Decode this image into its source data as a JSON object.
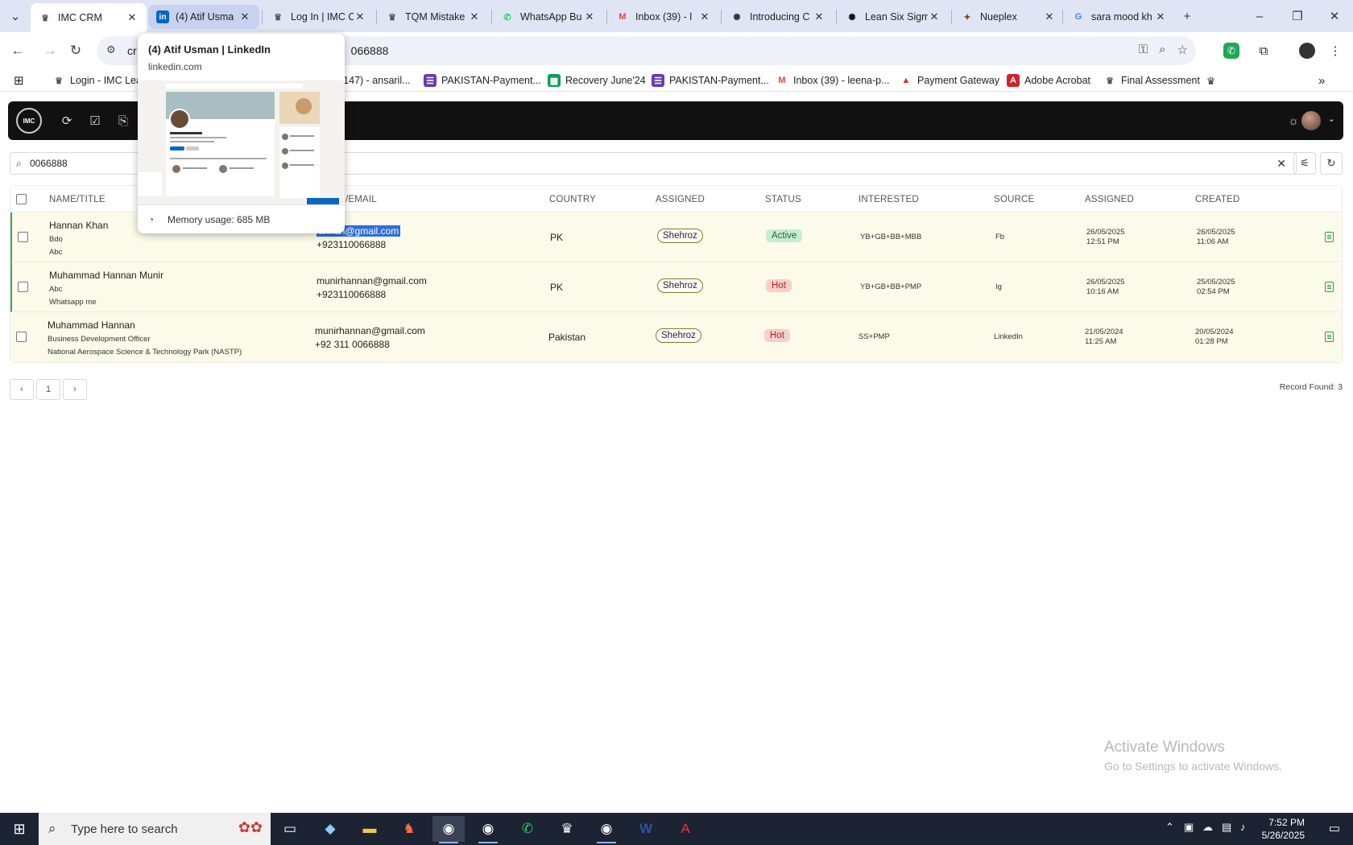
{
  "browser": {
    "tabs": [
      {
        "title": "IMC CRM",
        "icon": "imc-crm-icon",
        "icon_glyph": "♛",
        "icon_color": "#555555",
        "active": true
      },
      {
        "title": "(4) Atif Usma",
        "icon": "linkedin-icon",
        "icon_glyph": "in",
        "icon_color": "#0a66c2",
        "hovered": true
      },
      {
        "title": "Log In | IMC C",
        "icon": "imc-icon",
        "icon_glyph": "♛",
        "icon_color": "#555555"
      },
      {
        "title": "TQM Mistake",
        "icon": "imc-icon",
        "icon_glyph": "♛",
        "icon_color": "#555555"
      },
      {
        "title": "WhatsApp Bu",
        "icon": "whatsapp-icon",
        "icon_glyph": "✆",
        "icon_color": "#25d366"
      },
      {
        "title": "Inbox (39) - l",
        "icon": "gmail-icon",
        "icon_glyph": "M",
        "icon_color": "#ea4335"
      },
      {
        "title": "Introducing C",
        "icon": "openai-icon",
        "icon_glyph": "✺",
        "icon_color": "#333333"
      },
      {
        "title": "Lean Six Sigm",
        "icon": "chatgpt-icon",
        "icon_glyph": "✺",
        "icon_color": "#111111"
      },
      {
        "title": "Nueplex",
        "icon": "nueplex-icon",
        "icon_glyph": "✦",
        "icon_color": "#7a4a2a"
      },
      {
        "title": "sara mood kh",
        "icon": "google-icon",
        "icon_glyph": "G",
        "icon_color": "#4285f4"
      }
    ],
    "address": "cr",
    "address_tail": "066888",
    "bookmarks": [
      {
        "label": "Login - IMC Lea",
        "icon": "imc-icon",
        "glyph": "♛",
        "color": "#555555"
      },
      {
        "label": "(147) - ansaril...",
        "icon": "mail-icon",
        "glyph": "",
        "color": "#ffffff"
      },
      {
        "label": "PAKISTAN-Payment...",
        "icon": "forms-icon",
        "glyph": "☰",
        "color": "#673ab7"
      },
      {
        "label": "Recovery June'24",
        "icon": "sheets-icon",
        "glyph": "▦",
        "color": "#0f9d58"
      },
      {
        "label": "PAKISTAN-Payment...",
        "icon": "forms-icon",
        "glyph": "☰",
        "color": "#673ab7"
      },
      {
        "label": "Inbox (39) - leena-p...",
        "icon": "gmail-icon",
        "glyph": "M",
        "color": "#ea4335"
      },
      {
        "label": "Payment Gateway",
        "icon": "payment-icon",
        "glyph": "▲",
        "color": "#d93025"
      },
      {
        "label": "Adobe Acrobat",
        "icon": "acrobat-icon",
        "glyph": "A",
        "color": "#d4202a"
      },
      {
        "label": "Final Assessment",
        "icon": "imc-icon",
        "glyph": "♛",
        "color": "#555555"
      }
    ],
    "hover_card": {
      "title": "(4) Atif Usman | LinkedIn",
      "domain": "linkedin.com",
      "memory": "Memory usage: 685 MB"
    }
  },
  "app": {
    "search_value": "0066888",
    "columns": [
      "NAME/TITLE",
      "",
      "COUNTRY",
      "ASSIGNED",
      "STATUS",
      "INTERESTED",
      "SOURCE",
      "ASSIGNED",
      "CREATED"
    ],
    "contact_header_visible": "/EMAIL",
    "rows": [
      {
        "name": "Hannan Khan",
        "title": "Bdo",
        "company": "Abc",
        "email_hidden": "",
        "email_selected": "annan@gmail.com",
        "phone": "+923110066888",
        "country": "PK",
        "assigned_to": "Shehroz",
        "status": "Active",
        "status_kind": "active",
        "interested": "YB+GB+BB+MBB",
        "source": "Fb",
        "assigned_date": "26/05/2025",
        "assigned_time": "12:51 PM",
        "created_date": "26/05/2025",
        "created_time": "11:06 AM"
      },
      {
        "name": "Muhammad Hannan Munir",
        "title": "Abc",
        "company": "Whatsapp me",
        "email": "munirhannan@gmail.com",
        "phone": "+923110066888",
        "country": "PK",
        "assigned_to": "Shehroz",
        "status": "Hot",
        "status_kind": "hot",
        "interested": "YB+GB+BB+PMP",
        "source": "Ig",
        "assigned_date": "26/05/2025",
        "assigned_time": "10:16 AM",
        "created_date": "25/05/2025",
        "created_time": "02:54 PM"
      },
      {
        "name": "Muhammad Hannan",
        "title": "Business Development Officer",
        "company": "National Aerospace Science & Technology Park (NASTP)",
        "email": "munirhannan@gmail.com",
        "phone": "+92 311 0066888",
        "country": "Pakistan",
        "assigned_to": "Shehroz",
        "status": "Hot",
        "status_kind": "hot",
        "interested": "SS+PMP",
        "source": "LinkedIn",
        "assigned_date": "21/05/2024",
        "assigned_time": "11:25 AM",
        "created_date": "20/05/2024",
        "created_time": "01:28 PM"
      }
    ],
    "pagination": {
      "prev": "‹",
      "page": "1",
      "next": "›"
    },
    "record_found": "Record Found: 3"
  },
  "watermark": {
    "line1": "Activate Windows",
    "line2": "Go to Settings to activate Windows."
  },
  "taskbar": {
    "search_placeholder": "Type here to search",
    "time": "7:52 PM",
    "date": "5/26/2025"
  }
}
